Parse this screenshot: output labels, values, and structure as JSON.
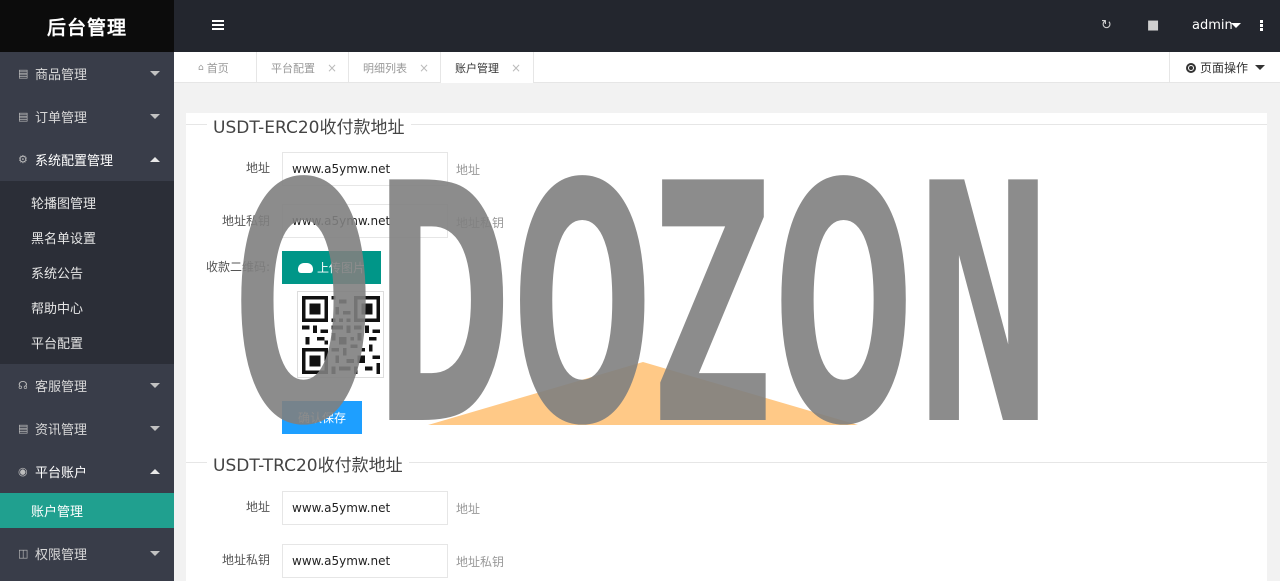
{
  "sidebar": {
    "logo": "后台管理",
    "groups": [
      {
        "label": "商品管理",
        "icon": "file-icon"
      },
      {
        "label": "订单管理",
        "icon": "document-icon"
      },
      {
        "label": "系统配置管理",
        "icon": "gear-icon"
      },
      {
        "label": "客服管理",
        "icon": "headset-icon"
      },
      {
        "label": "资讯管理",
        "icon": "file-icon"
      },
      {
        "label": "平台账户",
        "icon": "coin-icon"
      },
      {
        "label": "权限管理",
        "icon": "columns-icon"
      }
    ],
    "config_items": [
      "轮播图管理",
      "黑名单设置",
      "系统公告",
      "帮助中心",
      "平台配置"
    ],
    "account_items": [
      "账户管理"
    ]
  },
  "header": {
    "user": "admin"
  },
  "tabs": {
    "items": [
      "首页",
      "平台配置",
      "明细列表",
      "账户管理"
    ],
    "close": "×",
    "page_op": "页面操作"
  },
  "form": {
    "erc20": {
      "legend": "USDT-ERC20收付款地址",
      "address_label": "地址",
      "address_value": "www.a5ymw.net",
      "address_hint": "地址",
      "key_label": "地址私钥",
      "key_value": "www.a5ymw.net",
      "key_hint": "地址私钥",
      "qr_label": "收款二维码:",
      "upload_button": "上传图片",
      "save_button": "确认保存"
    },
    "trc20": {
      "legend": "USDT-TRC20收付款地址",
      "address_label": "地址",
      "address_value": "www.a5ymw.net",
      "address_hint": "地址",
      "key_label": "地址私钥",
      "key_value": "www.a5ymw.net",
      "key_hint": "地址私钥"
    }
  },
  "watermark": {
    "text": "ODOZON"
  },
  "colors": {
    "sidebar_bg": "#393d49",
    "header_bg": "#23262e",
    "accent_green": "#009688",
    "active_item": "#20a08f",
    "save_blue": "#1e9fff"
  }
}
